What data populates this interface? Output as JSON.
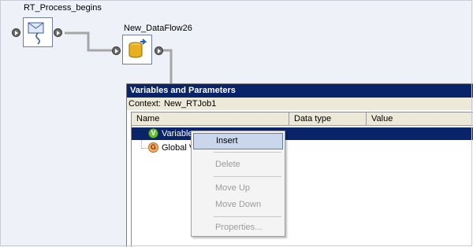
{
  "workflow": {
    "nodes": [
      {
        "label": "RT_Process_begins",
        "icon": "envelope-process-icon"
      },
      {
        "label": "New_DataFlow26",
        "icon": "database-dataflow-icon"
      }
    ]
  },
  "dialog": {
    "title": "Variables and Parameters",
    "context_label": "Context:",
    "context_value": "New_RTJob1",
    "columns": [
      "Name",
      "Data type",
      "Value"
    ],
    "rows": [
      {
        "icon_letter": "V",
        "icon": "variable-icon",
        "name": "Variables",
        "selected": true
      },
      {
        "icon_letter": "G",
        "icon": "global-variable-icon",
        "name": "Global Variables",
        "selected": false
      }
    ]
  },
  "context_menu": {
    "items": [
      {
        "label": "Insert",
        "enabled": true,
        "hovered": true
      },
      {
        "label": "Delete",
        "enabled": false
      },
      {
        "label": "Move Up",
        "enabled": false
      },
      {
        "label": "Move Down",
        "enabled": false
      },
      {
        "label": "Properties...",
        "enabled": false
      }
    ]
  },
  "colors": {
    "canvas": "#eef1f8",
    "title_bar": "#0a246a",
    "selection": "#0a246a",
    "menu_hover": "#c9d6ec"
  }
}
